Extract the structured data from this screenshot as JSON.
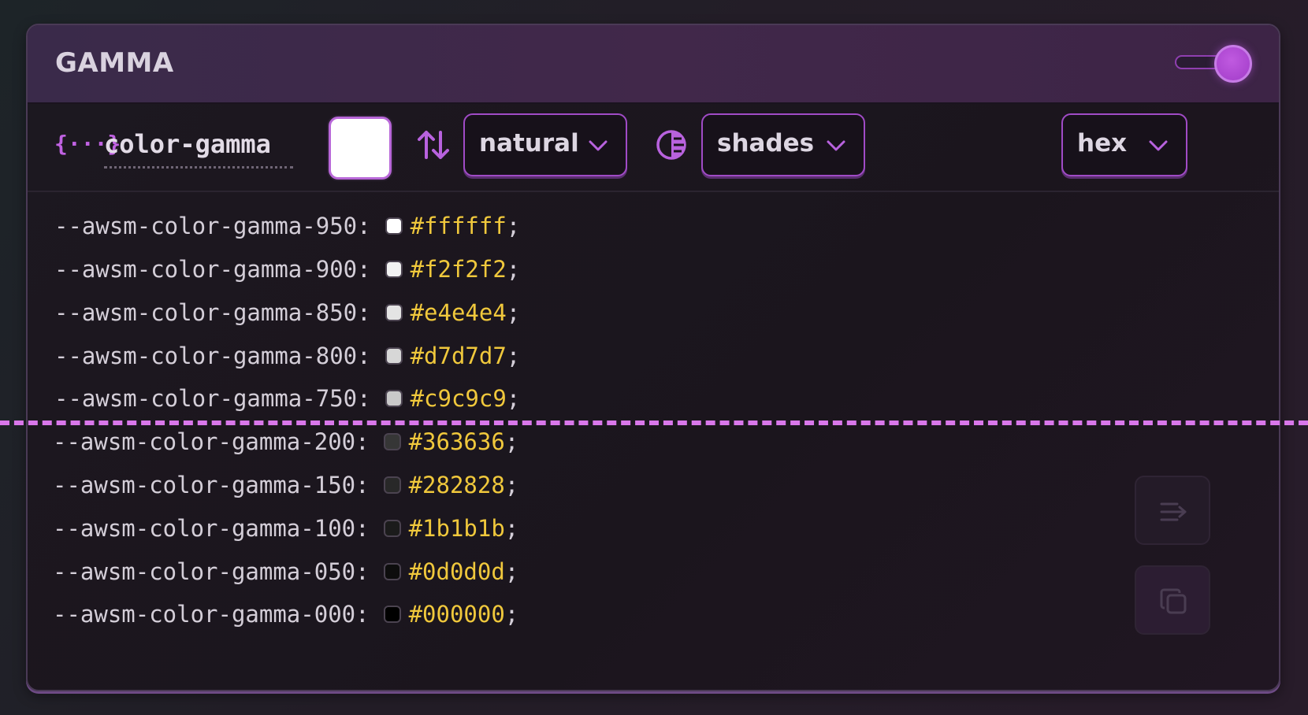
{
  "header": {
    "title": "GAMMA",
    "toggle_on": true
  },
  "toolbar": {
    "variable_name": "color-gamma",
    "base_color": "#ffffff",
    "mode_select": {
      "value": "natural"
    },
    "palette_select": {
      "value": "shades"
    },
    "format_select": {
      "value": "hex"
    }
  },
  "colors": {
    "accent": "#b862de",
    "hex_text": "#f0c83c",
    "divider": "#d977ea"
  },
  "code": {
    "top_rows": [
      {
        "var": "--awsm-color-gamma-950:",
        "hex": "#ffffff",
        "sep": ";"
      },
      {
        "var": "--awsm-color-gamma-900:",
        "hex": "#f2f2f2",
        "sep": ";"
      },
      {
        "var": "--awsm-color-gamma-850:",
        "hex": "#e4e4e4",
        "sep": ";"
      },
      {
        "var": "--awsm-color-gamma-800:",
        "hex": "#d7d7d7",
        "sep": ";"
      },
      {
        "var": "--awsm-color-gamma-750:",
        "hex": "#c9c9c9",
        "sep": ";"
      }
    ],
    "bottom_rows": [
      {
        "var": "--awsm-color-gamma-200:",
        "hex": "#363636",
        "sep": ";"
      },
      {
        "var": "--awsm-color-gamma-150:",
        "hex": "#282828",
        "sep": ";"
      },
      {
        "var": "--awsm-color-gamma-100:",
        "hex": "#1b1b1b",
        "sep": ";"
      },
      {
        "var": "--awsm-color-gamma-050:",
        "hex": "#0d0d0d",
        "sep": ";"
      },
      {
        "var": "--awsm-color-gamma-000:",
        "hex": "#000000",
        "sep": ";"
      }
    ]
  },
  "side_buttons": {
    "wrap_icon": "wrap-lines-icon",
    "copy_icon": "copy-icon"
  }
}
